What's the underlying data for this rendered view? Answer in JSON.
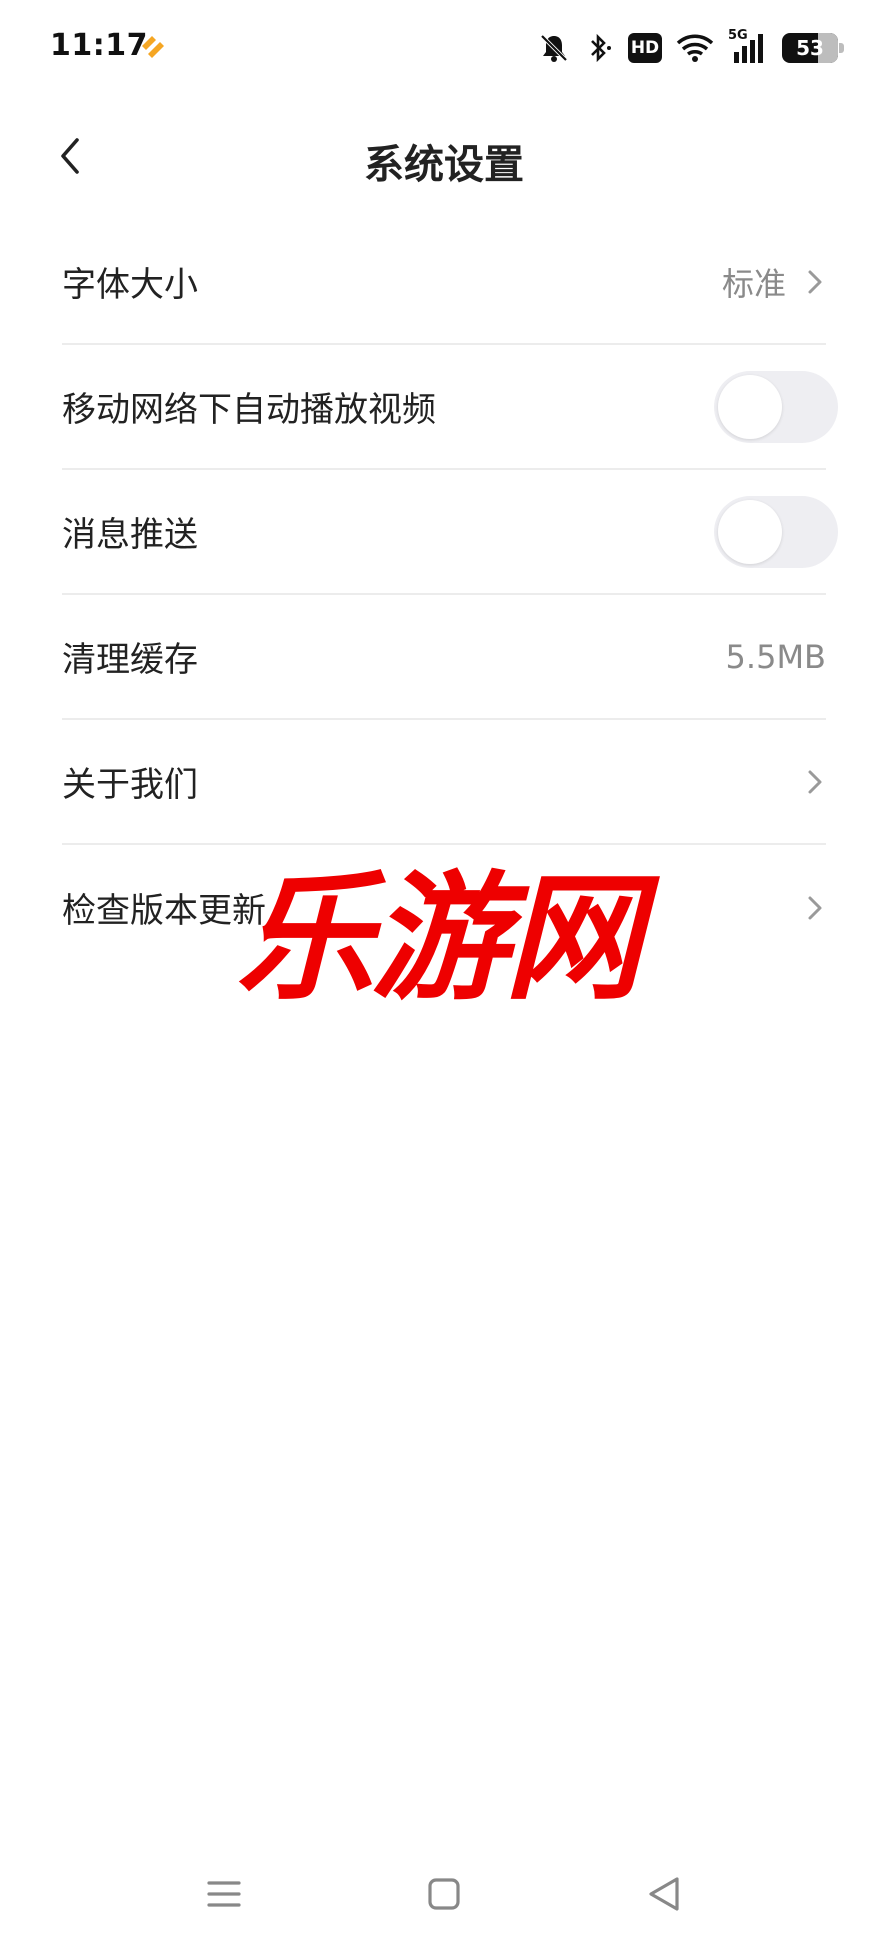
{
  "status_bar": {
    "time": "11:17",
    "battery_level": "53",
    "hd_label": "HD",
    "network_label": "5G",
    "icons": [
      "app-notification-icon",
      "mute-bell-icon",
      "bluetooth-icon",
      "hd-icon",
      "wifi-icon",
      "signal-5g-icon",
      "battery-icon"
    ],
    "app_icon_color": "#f5a623"
  },
  "header": {
    "title": "系统设置"
  },
  "settings": {
    "items": [
      {
        "label": "字体大小",
        "value": "标准",
        "control": "chevron"
      },
      {
        "label": "移动网络下自动播放视频",
        "control": "toggle",
        "enabled": false
      },
      {
        "label": "消息推送",
        "control": "toggle",
        "enabled": false
      },
      {
        "label": "清理缓存",
        "value": "5.5MB",
        "control": "value"
      },
      {
        "label": "关于我们",
        "control": "chevron"
      },
      {
        "label": "检查版本更新",
        "control": "chevron"
      }
    ]
  },
  "watermark": {
    "text": "乐游网",
    "color": "#ee0000"
  },
  "nav_bar": {
    "icons": [
      "menu-icon",
      "home-icon",
      "back-triangle-icon"
    ]
  }
}
